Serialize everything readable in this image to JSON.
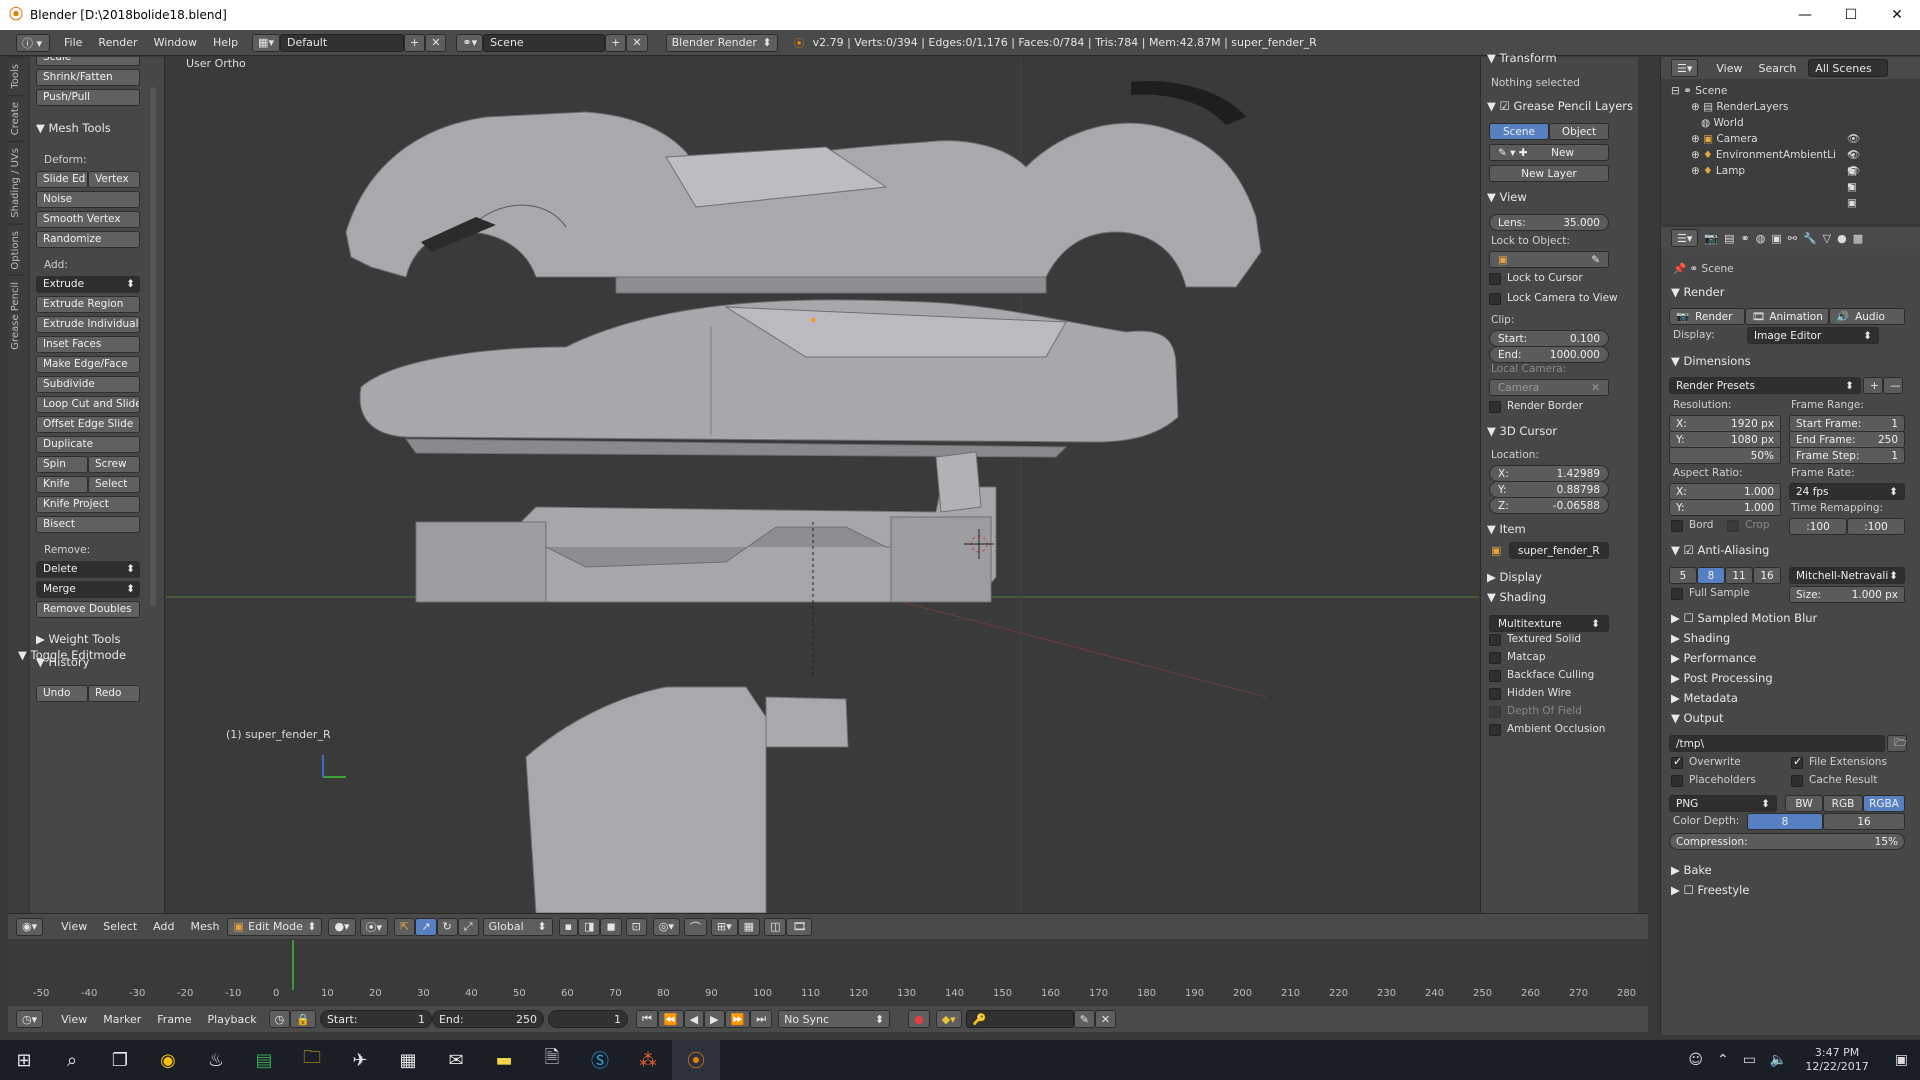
{
  "window": {
    "title": "Blender [D:\\2018bolide18.blend]",
    "controls": [
      "—",
      "☐",
      "✕"
    ]
  },
  "infobar": {
    "menus": [
      "File",
      "Render",
      "Window",
      "Help"
    ],
    "layout": "Default",
    "scene": "Scene",
    "engine": "Blender Render",
    "stats": "v2.79 | Verts:0/394 | Edges:0/1,176 | Faces:0/784 | Tris:784 | Mem:42.87M | super_fender_R"
  },
  "tabs": [
    "Tools",
    "Create",
    "Shading / UVs",
    "Options",
    "Grease Pencil"
  ],
  "toolshelf": {
    "top_items": [
      "Scale",
      "Shrink/Fatten",
      "Push/Pull"
    ],
    "mesh_tools": "Mesh Tools",
    "deform_label": "Deform:",
    "slide_edge": "Slide Ed",
    "vertex": "Vertex",
    "noise": "Noise",
    "smooth_vertex": "Smooth Vertex",
    "randomize": "Randomize",
    "add_label": "Add:",
    "extrude": "Extrude",
    "extrude_region": "Extrude Region",
    "extrude_individual": "Extrude Individual",
    "inset_faces": "Inset Faces",
    "make_edge_face": "Make Edge/Face",
    "subdivide": "Subdivide",
    "loop_cut": "Loop Cut and Slide",
    "offset_edge": "Offset Edge Slide",
    "duplicate": "Duplicate",
    "spin": "Spin",
    "screw": "Screw",
    "knife": "Knife",
    "select": "Select",
    "knife_project": "Knife Project",
    "bisect": "Bisect",
    "remove_label": "Remove:",
    "delete": "Delete",
    "merge": "Merge",
    "remove_doubles": "Remove Doubles",
    "weight_tools": "Weight Tools",
    "history": "History",
    "undo": "Undo",
    "redo": "Redo",
    "toggle_editmode": "Toggle Editmode"
  },
  "viewport": {
    "view_name": "User Ortho",
    "object_label": "(1) super_fender_R"
  },
  "npanel": {
    "transform": "Transform",
    "nothing_selected": "Nothing selected",
    "grease_pencil": "Grease Pencil Layers",
    "scene_btn": "Scene",
    "object_btn": "Object",
    "new_btn": "New",
    "new_layer": "New Layer",
    "view": "View",
    "lens_label": "Lens:",
    "lens_value": "35.000",
    "lock_to_object": "Lock to Object:",
    "lock_to_cursor": "Lock to Cursor",
    "lock_camera": "Lock Camera to View",
    "clip": "Clip:",
    "clip_start_label": "Start:",
    "clip_start": "0.100",
    "clip_end_label": "End:",
    "clip_end": "1000.000",
    "local_camera": "Local Camera:",
    "camera": "Camera",
    "render_border": "Render Border",
    "cursor": "3D Cursor",
    "location": "Location:",
    "cx_label": "X:",
    "cx": "1.42989",
    "cy_label": "Y:",
    "cy": "0.88798",
    "cz_label": "Z:",
    "cz": "-0.06588",
    "item": "Item",
    "item_name": "super_fender_R",
    "display": "Display",
    "shading": "Shading",
    "multitexture": "Multitexture",
    "textured_solid": "Textured Solid",
    "matcap": "Matcap",
    "backface": "Backface Culling",
    "hidden_wire": "Hidden Wire",
    "dof": "Depth Of Field",
    "ao": "Ambient Occlusion"
  },
  "outliner": {
    "view": "View",
    "search": "Search",
    "all_scenes": "All Scenes",
    "items": [
      "Scene",
      "RenderLayers",
      "World",
      "Camera",
      "EnvironmentAmbientLi",
      "Lamp"
    ]
  },
  "props": {
    "scene": "Scene",
    "render": "Render",
    "render_btn": "Render",
    "animation_btn": "Animation",
    "audio_btn": "Audio",
    "display_label": "Display:",
    "display_value": "Image Editor",
    "dimensions": "Dimensions",
    "render_presets": "Render Presets",
    "resolution": "Resolution:",
    "frame_range": "Frame Range:",
    "res_x_label": "X:",
    "res_x": "1920 px",
    "res_y_label": "Y:",
    "res_y": "1080 px",
    "res_pct": "50%",
    "start_frame_label": "Start Frame:",
    "start_frame": "1",
    "end_frame_label": "End Frame:",
    "end_frame": "250",
    "frame_step_label": "Frame Step:",
    "frame_step": "1",
    "aspect": "Aspect Ratio:",
    "frame_rate": "Frame Rate:",
    "asp_x_label": "X:",
    "asp_x": "1.000",
    "asp_y_label": "Y:",
    "asp_y": "1.000",
    "fps": "24 fps",
    "time_remap": "Time Remapping:",
    "remap_old": ":100",
    "remap_new": ":100",
    "bord": "Bord",
    "crop": "Crop",
    "anti_aliasing": "Anti-Aliasing",
    "aa_values": [
      "5",
      "8",
      "11",
      "16"
    ],
    "aa_filter": "Mitchell-Netravali",
    "full_sample": "Full Sample",
    "size_label": "Size:",
    "size_value": "1.000 px",
    "motion_blur": "Sampled Motion Blur",
    "shading": "Shading",
    "performance": "Performance",
    "post_processing": "Post Processing",
    "metadata": "Metadata",
    "output": "Output",
    "path": "/tmp\\",
    "overwrite": "Overwrite",
    "file_extensions": "File Extensions",
    "placeholders": "Placeholders",
    "cache_result": "Cache Result",
    "format": "PNG",
    "bw": "BW",
    "rgb": "RGB",
    "rgba": "RGBA",
    "color_depth": "Color Depth:",
    "depth_8": "8",
    "depth_16": "16",
    "compression_label": "Compression:",
    "compression": "15%",
    "bake": "Bake",
    "freestyle": "Freestyle"
  },
  "vheader": {
    "menus": [
      "View",
      "Select",
      "Add",
      "Mesh"
    ],
    "mode": "Edit Mode",
    "orientation": "Global"
  },
  "timeline": {
    "ruler": [
      "-50",
      "-40",
      "-30",
      "-20",
      "-10",
      "0",
      "10",
      "20",
      "30",
      "40",
      "50",
      "60",
      "70",
      "80",
      "90",
      "100",
      "110",
      "120",
      "130",
      "140",
      "150",
      "160",
      "170",
      "180",
      "190",
      "200",
      "210",
      "220",
      "230",
      "240",
      "250",
      "260",
      "270",
      "280"
    ],
    "menus": [
      "View",
      "Marker",
      "Frame",
      "Playback"
    ],
    "start_label": "Start:",
    "start": "1",
    "end_label": "End:",
    "end": "250",
    "current": "1",
    "sync": "No Sync"
  },
  "taskbar": {
    "time": "3:47 PM",
    "date": "12/22/2017"
  },
  "colors": {
    "accent": "#5680c2",
    "orange": "#e87d0d",
    "panel": "#474747",
    "viewport": "#393939"
  }
}
